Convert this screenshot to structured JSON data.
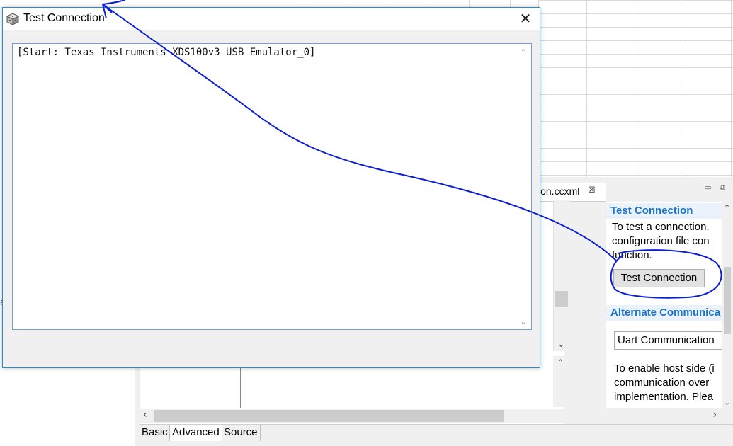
{
  "dialog": {
    "title": "Test Connection",
    "close_glyph": "✕",
    "console_text": "[Start: Texas Instruments XDS100v3 USB Emulator_0]",
    "icon": "cube-icon"
  },
  "editor": {
    "tab_label": "ion.ccxml",
    "tab_close_glyph": "⊠",
    "minimize_glyph": "▭",
    "maximize_glyph": "⧉"
  },
  "properties": {
    "test_connection": {
      "heading": "Test Connection",
      "line1": "To test a connection,",
      "line2": "configuration file con",
      "line3": "function.",
      "button_label": "Test Connection"
    },
    "alternate": {
      "heading": "Alternate Communica",
      "uart_value": "Uart Communication",
      "line1": "To enable host side (i",
      "line2": "communication over",
      "line3": "implementation. Plea",
      "line4": "..."
    }
  },
  "bottom_tabs": [
    "Basic",
    "Advanced",
    "Source"
  ],
  "left_edge_char": "e",
  "colors": {
    "annotation_ink": "#0a1fd6",
    "section_heading": "#1a73c7",
    "dialog_border": "#1f8fd6"
  }
}
